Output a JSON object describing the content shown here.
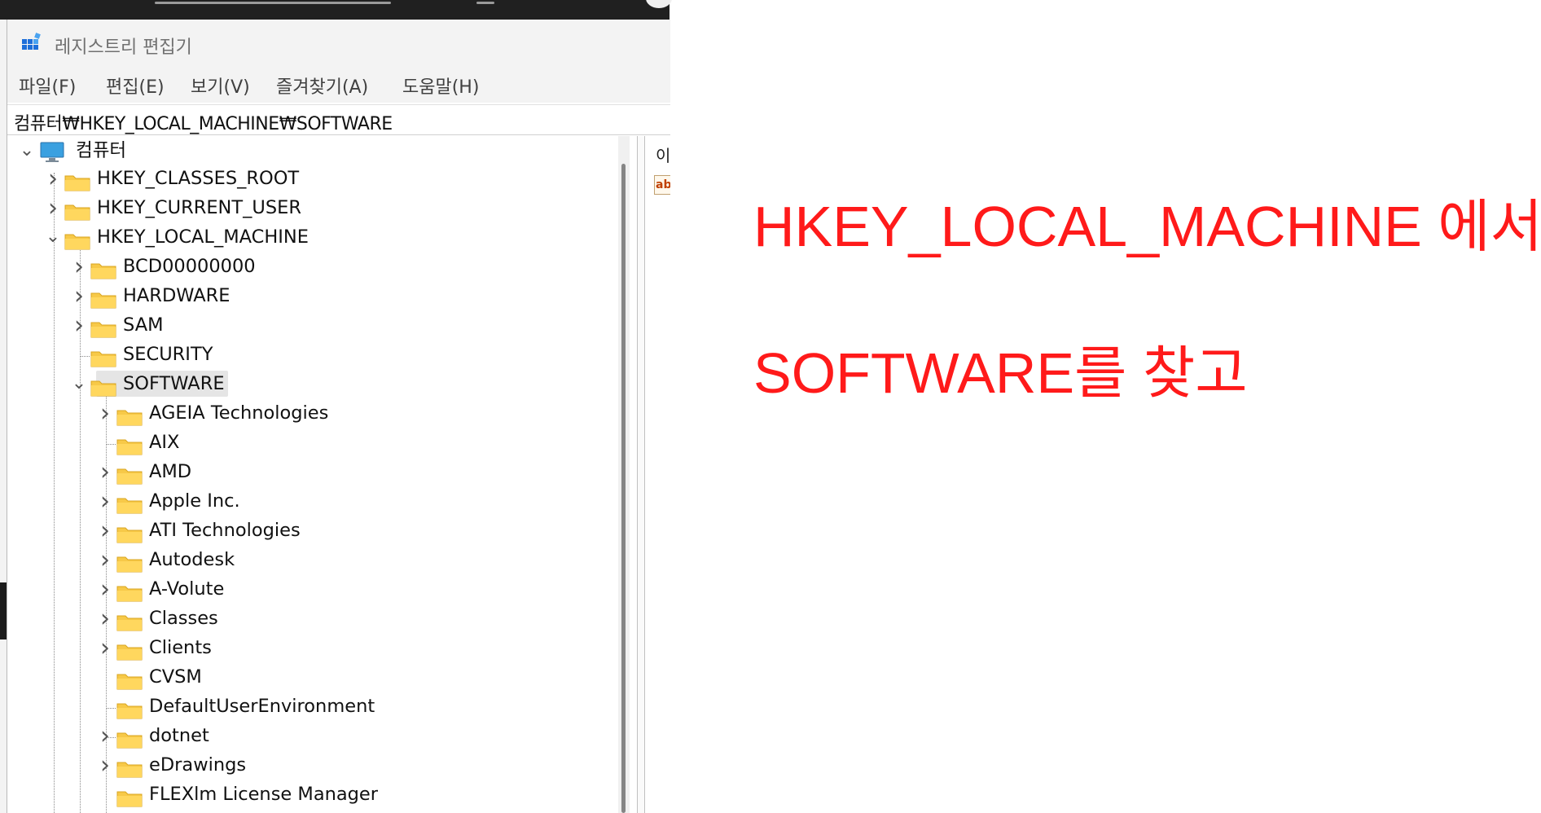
{
  "window": {
    "title": "레지스트리 편집기",
    "menu": [
      "파일(F)",
      "편집(E)",
      "보기(V)",
      "즐겨찾기(A)",
      "도움말(H)"
    ],
    "address": "컴퓨터₩HKEY_LOCAL_MACHINE₩SOFTWARE"
  },
  "tree": {
    "root": "컴퓨터",
    "hives": [
      "HKEY_CLASSES_ROOT",
      "HKEY_CURRENT_USER",
      "HKEY_LOCAL_MACHINE"
    ],
    "hklm_children": [
      "BCD00000000",
      "HARDWARE",
      "SAM",
      "SECURITY",
      "SOFTWARE"
    ],
    "selected": "SOFTWARE",
    "software_children": [
      "AGEIA Technologies",
      "AIX",
      "AMD",
      "Apple Inc.",
      "ATI Technologies",
      "Autodesk",
      "A-Volute",
      "Classes",
      "Clients",
      "CVSM",
      "DefaultUserEnvironment",
      "dotnet",
      "eDrawings",
      "FLEXlm License Manager"
    ]
  },
  "right_pane": {
    "header": "이",
    "icon": "ab"
  },
  "annotation": {
    "line1": "HKEY_LOCAL_MACHINE 에서",
    "line2": "SOFTWARE를 찾고",
    "color": "#ff1a1a"
  },
  "icons": {
    "app": "registry-editor-icon",
    "computer": "computer-icon",
    "folder": "folder-icon",
    "expand": "chevron-right-icon",
    "collapse": "chevron-down-icon",
    "string_value": "string-value-icon"
  }
}
